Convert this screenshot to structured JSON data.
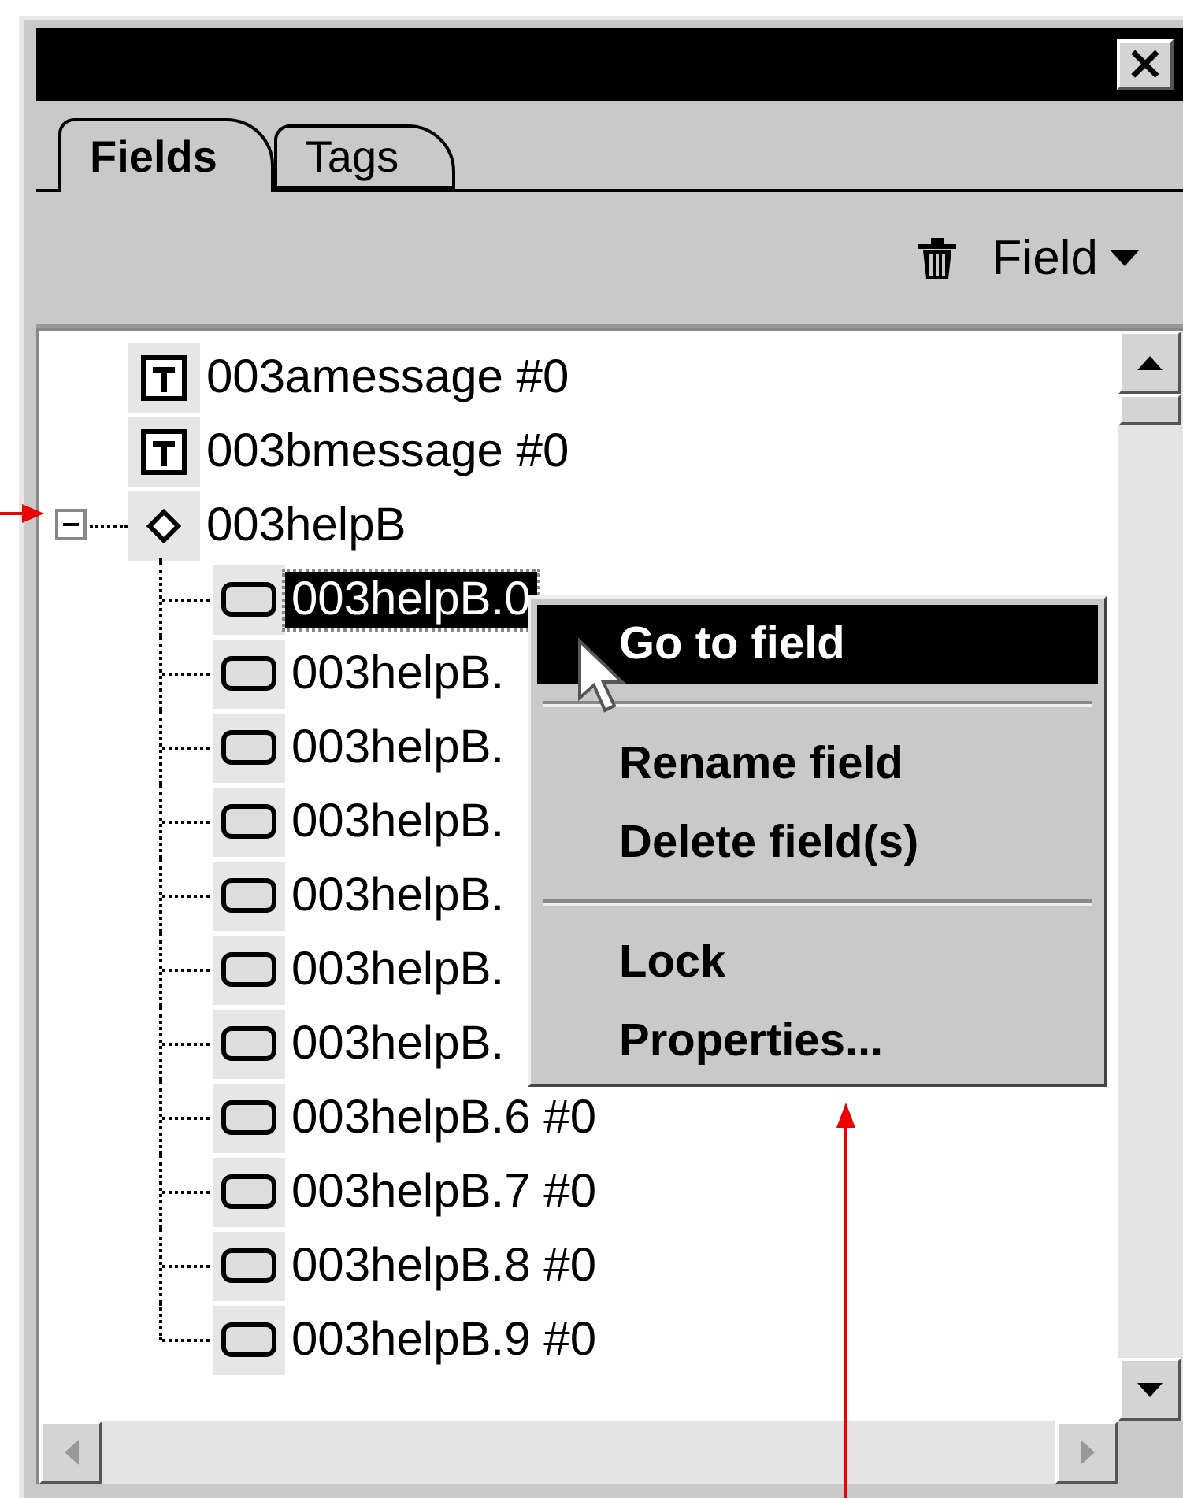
{
  "window": {
    "close": "×"
  },
  "tabs": [
    {
      "label": "Fields",
      "selected": true
    },
    {
      "label": "Tags",
      "selected": false
    }
  ],
  "toolbar": {
    "menu_label": "Field"
  },
  "tree": [
    {
      "kind": "text",
      "label": "003amessage #0",
      "selected": false
    },
    {
      "kind": "text",
      "label": "003bmessage #0",
      "selected": false
    },
    {
      "kind": "group",
      "label": "003helpB",
      "selected": false,
      "expanded": true,
      "children": [
        {
          "kind": "button",
          "label": "003helpB.0",
          "selected": true
        },
        {
          "kind": "button",
          "label": "003helpB.",
          "selected": false
        },
        {
          "kind": "button",
          "label": "003helpB.",
          "selected": false
        },
        {
          "kind": "button",
          "label": "003helpB.",
          "selected": false
        },
        {
          "kind": "button",
          "label": "003helpB.",
          "selected": false
        },
        {
          "kind": "button",
          "label": "003helpB.",
          "selected": false
        },
        {
          "kind": "button",
          "label": "003helpB.",
          "selected": false
        },
        {
          "kind": "button",
          "label": "003helpB.6 #0",
          "selected": false
        },
        {
          "kind": "button",
          "label": "003helpB.7 #0",
          "selected": false
        },
        {
          "kind": "button",
          "label": "003helpB.8 #0",
          "selected": false
        },
        {
          "kind": "button",
          "label": "003helpB.9 #0",
          "selected": false
        }
      ]
    }
  ],
  "context_menu": [
    {
      "kind": "item",
      "label": "Go to field",
      "selected": true
    },
    {
      "kind": "separator"
    },
    {
      "kind": "item",
      "label": "Rename field",
      "selected": false
    },
    {
      "kind": "item",
      "label": "Delete field(s)",
      "selected": false
    },
    {
      "kind": "separator"
    },
    {
      "kind": "item",
      "label": "Lock",
      "selected": false
    },
    {
      "kind": "item",
      "label": "Properties...",
      "selected": false
    }
  ]
}
